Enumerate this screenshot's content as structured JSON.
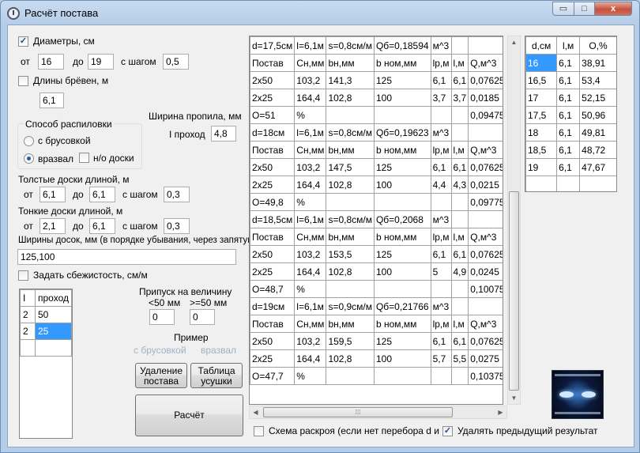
{
  "window": {
    "title": "Расчёт постава",
    "min": "▭",
    "max": "□",
    "close": "x"
  },
  "params": {
    "diameters": {
      "label": "Диаметры, см",
      "checked": true,
      "from_label": "от",
      "from": "16",
      "to_label": "до",
      "to": "19",
      "step_label": "с шагом",
      "step": "0,5"
    },
    "log_length": {
      "label": "Длины брёвен, м",
      "checked": false,
      "value": "6,1"
    },
    "kerf": {
      "title": "Ширина пропила, мм",
      "pass_label": "I проход",
      "pass_value": "4,8"
    },
    "method": {
      "title": "Способ распиловки",
      "option1": "с брусовкой",
      "option2": "вразвал",
      "uncut": "н/о доски",
      "selected": "вразвал"
    },
    "thick": {
      "title": "Толстые доски длиной, м",
      "from_label": "от",
      "from": "6,1",
      "to_label": "до",
      "to": "6,1",
      "step_label": "с шагом",
      "step": "0,3"
    },
    "thin": {
      "title": "Тонкие доски длиной, м",
      "from_label": "от",
      "from": "2,1",
      "to_label": "до",
      "to": "6,1",
      "step_label": "с шагом",
      "step": "0,3"
    },
    "widths": {
      "title": "Ширины досок, мм (в порядке убывания, через запятую)",
      "value": "125,100"
    },
    "taper": {
      "label": "Задать сбежистость, см/м",
      "checked": false
    }
  },
  "passes_grid": {
    "headers": [
      "I",
      "проход"
    ],
    "rows": [
      {
        "i": "2",
        "pass": "50"
      },
      {
        "i": "2",
        "pass": "25"
      }
    ]
  },
  "allowance": {
    "title1": "Припуск на величину",
    "lt": "<50 мм",
    "ge": ">=50 мм",
    "lt_value": "0",
    "ge_value": "0"
  },
  "example": {
    "title": "Пример",
    "opt1": "с брусовкой",
    "opt2": "вразвал"
  },
  "buttons": {
    "delete": "Удаление постава",
    "table": "Таблица усушки",
    "calc": "Расчёт"
  },
  "results": [
    {
      "header": [
        "d=17,5см",
        "l=6,1м",
        "s=0,8см/м",
        "Qб=0,18594",
        "м^3"
      ],
      "colheads": [
        "Постав",
        "Сн,мм",
        "bн,мм",
        "b ном,мм",
        "lр,м",
        "l,м",
        "Q,м^3"
      ],
      "rows": [
        [
          "2x50",
          "103,2",
          "141,3",
          "125",
          "6,1",
          "6,1",
          "0,07625"
        ],
        [
          "2x25",
          "164,4",
          "102,8",
          "100",
          "3,7",
          "3,7",
          "0,0185"
        ]
      ],
      "footer": [
        "O=51",
        "%",
        "0,09475"
      ]
    },
    {
      "header": [
        "d=18см",
        "l=6,1м",
        "s=0,8см/м",
        "Qб=0,19623",
        "м^3"
      ],
      "colheads": [
        "Постав",
        "Сн,мм",
        "bн,мм",
        "b ном,мм",
        "lр,м",
        "l,м",
        "Q,м^3"
      ],
      "rows": [
        [
          "2x50",
          "103,2",
          "147,5",
          "125",
          "6,1",
          "6,1",
          "0,07625"
        ],
        [
          "2x25",
          "164,4",
          "102,8",
          "100",
          "4,4",
          "4,3",
          "0,0215"
        ]
      ],
      "footer": [
        "O=49,8",
        "%",
        "0,09775"
      ]
    },
    {
      "header": [
        "d=18,5см",
        "l=6,1м",
        "s=0,8см/м",
        "Qб=0,2068",
        "м^3"
      ],
      "colheads": [
        "Постав",
        "Сн,мм",
        "bн,мм",
        "b ном,мм",
        "lр,м",
        "l,м",
        "Q,м^3"
      ],
      "rows": [
        [
          "2x50",
          "103,2",
          "153,5",
          "125",
          "6,1",
          "6,1",
          "0,07625"
        ],
        [
          "2x25",
          "164,4",
          "102,8",
          "100",
          "5",
          "4,9",
          "0,0245"
        ]
      ],
      "footer": [
        "O=48,7",
        "%",
        "0,10075"
      ]
    },
    {
      "header": [
        "d=19см",
        "l=6,1м",
        "s=0,9см/м",
        "Qб=0,21766",
        "м^3"
      ],
      "colheads": [
        "Постав",
        "Сн,мм",
        "bн,мм",
        "b ном,мм",
        "lр,м",
        "l,м",
        "Q,м^3"
      ],
      "rows": [
        [
          "2x50",
          "103,2",
          "159,5",
          "125",
          "6,1",
          "6,1",
          "0,07625"
        ],
        [
          "2x25",
          "164,4",
          "102,8",
          "100",
          "5,7",
          "5,5",
          "0,0275"
        ]
      ],
      "footer": [
        "O=47,7",
        "%",
        "0,10375"
      ]
    }
  ],
  "summary": {
    "headers": [
      "d,см",
      "l,м",
      "O,%"
    ],
    "rows": [
      [
        "16",
        "6,1",
        "38,91"
      ],
      [
        "16,5",
        "6,1",
        "53,4"
      ],
      [
        "17",
        "6,1",
        "52,15"
      ],
      [
        "17,5",
        "6,1",
        "50,96"
      ],
      [
        "18",
        "6,1",
        "49,81"
      ],
      [
        "18,5",
        "6,1",
        "48,72"
      ],
      [
        "19",
        "6,1",
        "47,67"
      ]
    ]
  },
  "bottom": {
    "scheme_label": "Схема раскроя (если нет перебора d и l).",
    "scheme_checked": false,
    "delete_prev_label": "Удалять предыдущий результат",
    "delete_prev_checked": true
  }
}
